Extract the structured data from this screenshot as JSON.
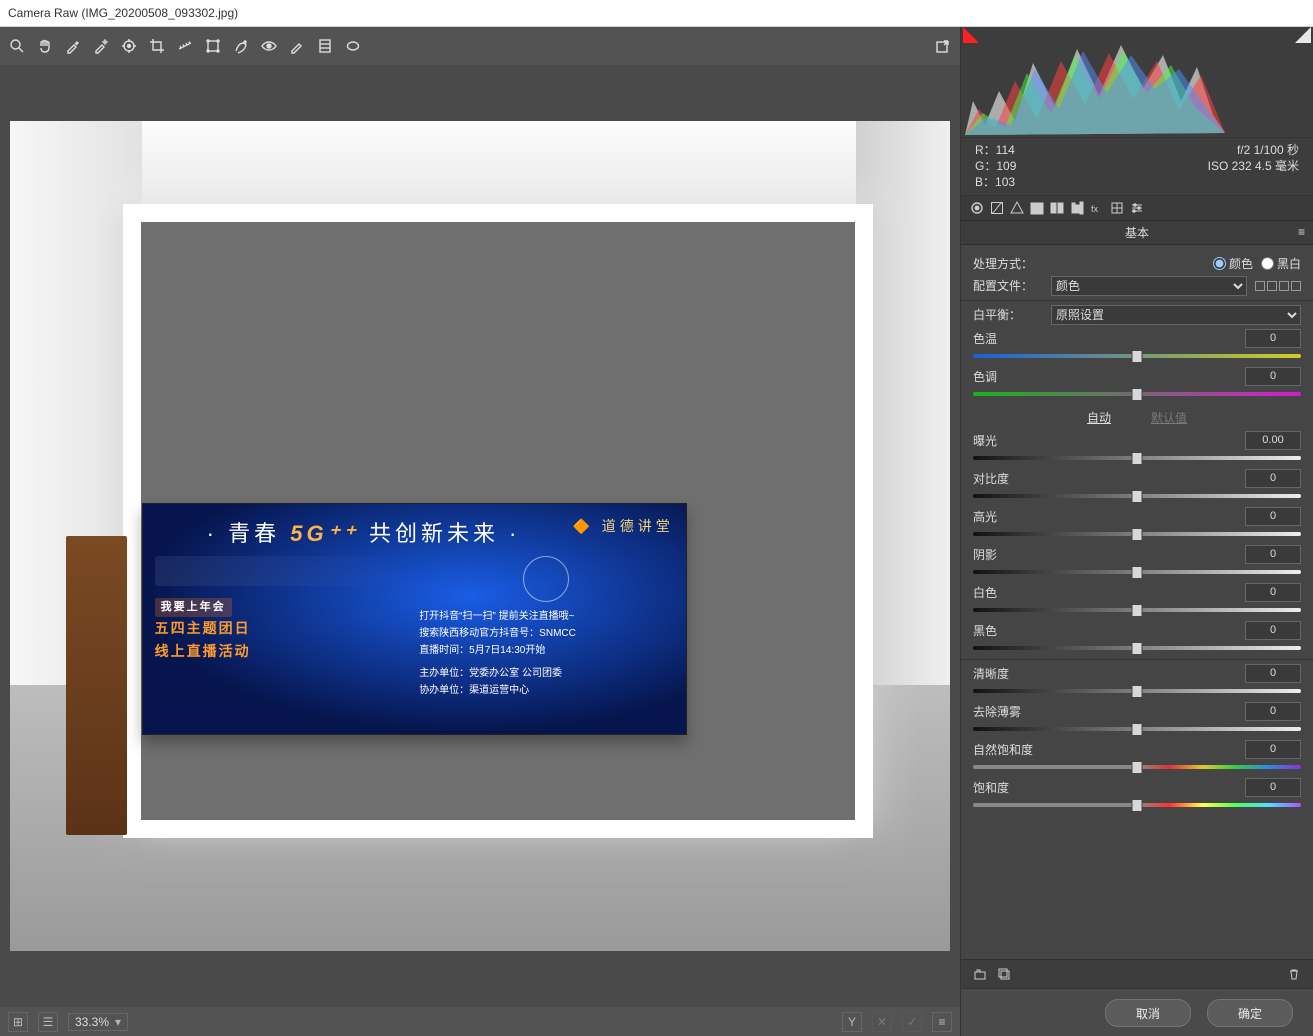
{
  "window": {
    "title": "Camera Raw (IMG_20200508_093302.jpg)"
  },
  "toolbar_icons": [
    "zoom",
    "hand",
    "eyedrop-wb",
    "eyedrop-color",
    "target",
    "crop",
    "straighten",
    "transform",
    "spot",
    "redeye",
    "brush",
    "grad",
    "radial",
    "prefs"
  ],
  "toolbar_right_icon": "export-icon",
  "preview": {
    "screen_heading_pre": "· 青春",
    "screen_heading_big": "5G⁺⁺",
    "screen_heading_post": "共创新未来 ·",
    "lecture_label": "道德讲堂",
    "event_line0": "我要上年会",
    "event_line1": "五四主题团日",
    "event_line2": "线上直播活动",
    "info_line1": "打开抖音“扫一扫”   提前关注直播哦~",
    "info_line2": "搜索陕西移动官方抖音号：SNMCC",
    "info_line3": "直播时间：5月7日14:30开始",
    "info_line4": "主办单位：党委办公室  公司团委",
    "info_line5": "协办单位：渠道运营中心"
  },
  "bottombar": {
    "zoom": "33.3%",
    "yy_label": "Y"
  },
  "readout": {
    "r_lab": "R：",
    "r": "114",
    "g_lab": "G：",
    "g": "109",
    "b_lab": "B：",
    "b": "103",
    "exposure": "f/2  1/100 秒",
    "iso": "ISO 232  4.5 毫米"
  },
  "panel": {
    "title": "基本",
    "treatment_label": "处理方式：",
    "treatment_color": "颜色",
    "treatment_bw": "黑白",
    "profile_label": "配置文件：",
    "profile_value": "颜色",
    "wb_label": "白平衡：",
    "wb_value": "原照设置",
    "auto": "自动",
    "default": "默认值",
    "sliders": {
      "temp": {
        "label": "色温",
        "value": "0"
      },
      "tint": {
        "label": "色调",
        "value": "0"
      },
      "exposure": {
        "label": "曝光",
        "value": "0.00"
      },
      "contrast": {
        "label": "对比度",
        "value": "0"
      },
      "highlights": {
        "label": "高光",
        "value": "0"
      },
      "shadows": {
        "label": "阴影",
        "value": "0"
      },
      "whites": {
        "label": "白色",
        "value": "0"
      },
      "blacks": {
        "label": "黑色",
        "value": "0"
      },
      "clarity": {
        "label": "清晰度",
        "value": "0"
      },
      "dehaze": {
        "label": "去除薄雾",
        "value": "0"
      },
      "vibrance": {
        "label": "自然饱和度",
        "value": "0"
      },
      "saturation": {
        "label": "饱和度",
        "value": "0"
      }
    }
  },
  "footer": {
    "cancel": "取消",
    "ok": "确定"
  }
}
